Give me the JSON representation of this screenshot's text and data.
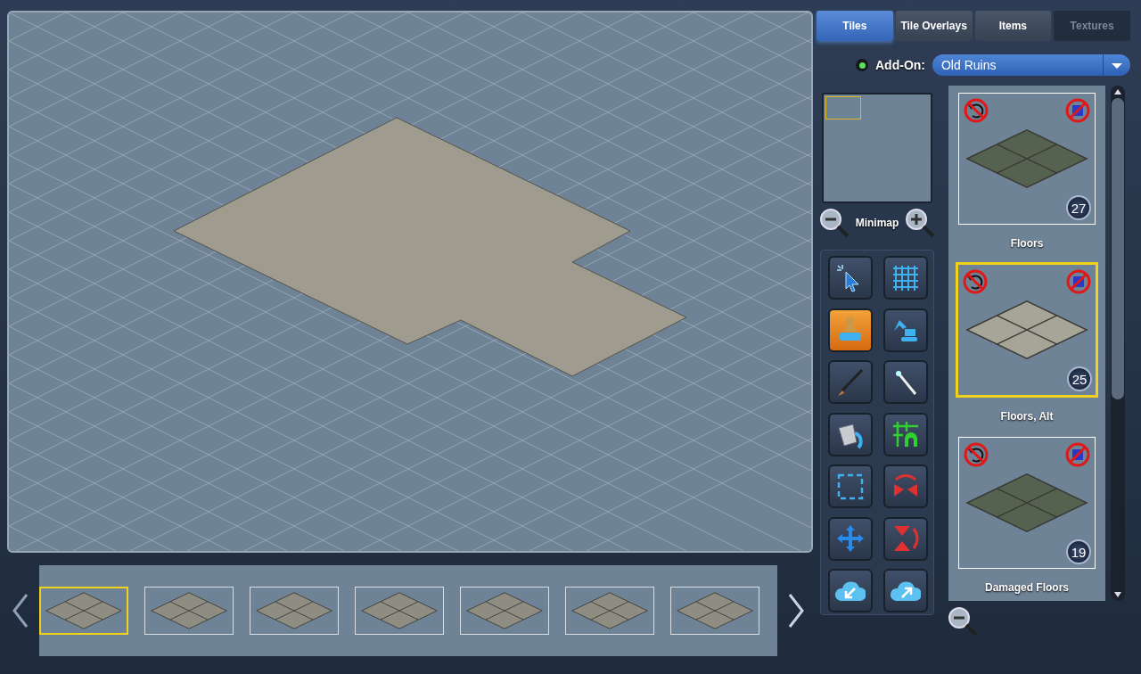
{
  "tabs": [
    {
      "label": "Tiles",
      "selected": true,
      "disabled": false
    },
    {
      "label": "Tile Overlays",
      "selected": false,
      "disabled": false
    },
    {
      "label": "Items",
      "selected": false,
      "disabled": false
    },
    {
      "label": "Textures",
      "selected": false,
      "disabled": true
    }
  ],
  "addon": {
    "on": true,
    "label": "Add-On:",
    "value": "Old Ruins"
  },
  "minimap": {
    "label": "Minimap"
  },
  "tools": [
    {
      "kind": "pointer",
      "selected": false
    },
    {
      "kind": "grid",
      "selected": false
    },
    {
      "kind": "stamp",
      "selected": true
    },
    {
      "kind": "excavator",
      "selected": false
    },
    {
      "kind": "brush",
      "selected": false
    },
    {
      "kind": "wand",
      "selected": false
    },
    {
      "kind": "bucket",
      "selected": false
    },
    {
      "kind": "grid-arch",
      "selected": false
    },
    {
      "kind": "marquee",
      "selected": false
    },
    {
      "kind": "flip-h",
      "selected": false
    },
    {
      "kind": "move",
      "selected": false
    },
    {
      "kind": "flip-v",
      "selected": false
    },
    {
      "kind": "import",
      "selected": false
    },
    {
      "kind": "export",
      "selected": false
    }
  ],
  "tile_sets": [
    {
      "name": "Floors",
      "count": "27",
      "selected": false,
      "kind": "dark"
    },
    {
      "name": "Floors, Alt",
      "count": "25",
      "selected": true,
      "kind": "light"
    },
    {
      "name": "Damaged Floors",
      "count": "19",
      "selected": false,
      "kind": "dark"
    }
  ],
  "filmstrip": [
    {
      "selected": true
    },
    {
      "selected": false
    },
    {
      "selected": false
    },
    {
      "selected": false
    },
    {
      "selected": false
    },
    {
      "selected": false
    },
    {
      "selected": false
    }
  ]
}
